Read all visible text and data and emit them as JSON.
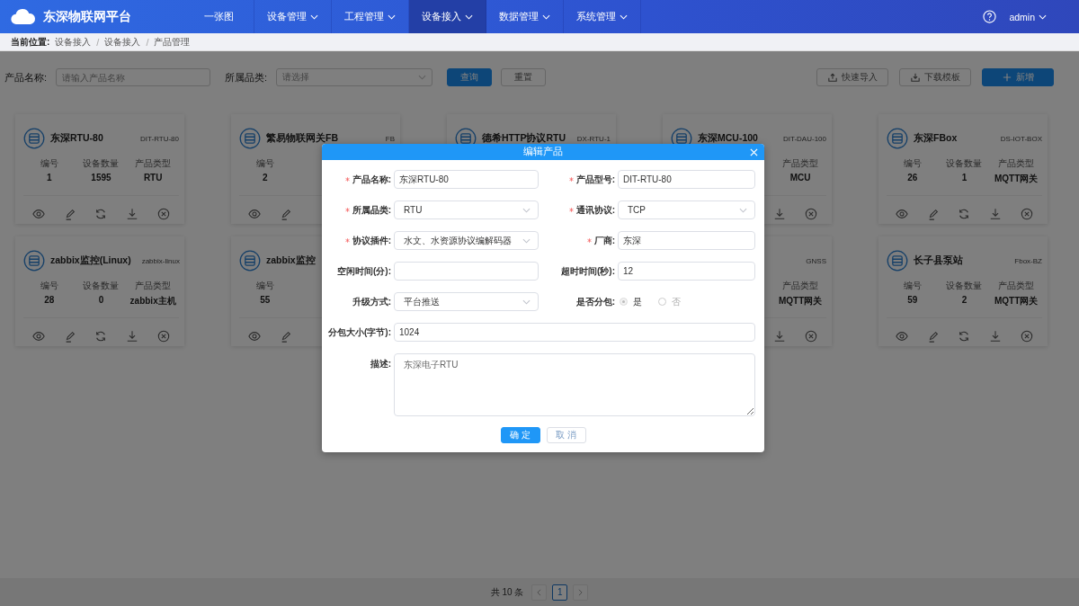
{
  "header": {
    "logo": "东深物联网平台",
    "nav": [
      {
        "label": "一张图",
        "dropdown": false,
        "selected": false
      },
      {
        "label": "设备管理",
        "dropdown": true,
        "selected": false
      },
      {
        "label": "工程管理",
        "dropdown": true,
        "selected": false
      },
      {
        "label": "设备接入",
        "dropdown": true,
        "selected": true
      },
      {
        "label": "数据管理",
        "dropdown": true,
        "selected": false
      },
      {
        "label": "系统管理",
        "dropdown": true,
        "selected": false
      }
    ],
    "user": "admin"
  },
  "breadcrumb": {
    "label": "当前位置:",
    "separator": "/",
    "items": [
      "设备接入",
      "设备接入",
      "产品管理"
    ]
  },
  "toolbar": {
    "filters": [
      {
        "label": "产品名称:",
        "kind": "text",
        "placeholder": "请输入产品名称"
      },
      {
        "label": "所属品类:",
        "kind": "select",
        "placeholder": "请选择"
      }
    ],
    "buttons": [
      {
        "label": "查询",
        "kind": "primary"
      },
      {
        "label": "重置",
        "kind": "default"
      }
    ],
    "actions": [
      {
        "label": "快速导入",
        "kind": "import"
      },
      {
        "label": "下载模板",
        "kind": "download"
      },
      {
        "label": "新增",
        "kind": "add"
      }
    ]
  },
  "card_rows": [
    [
      [
        {
          "title": "东深RTU-80",
          "code": "DIT-RTU-80",
          "stats": [
            {
              "kind": "id",
              "label": "编号",
              "value": "1"
            },
            {
              "kind": "count",
              "label": "设备数量",
              "value": "1595"
            },
            {
              "kind": "type",
              "label": "产品类型",
              "value": "RTU"
            }
          ],
          "actions": [
            {
              "kind": "view"
            },
            {
              "kind": "edit"
            },
            {
              "kind": "sync"
            },
            {
              "kind": "download"
            },
            {
              "kind": "delete"
            }
          ]
        },
        {
          "title": "繁易物联网关FB",
          "code": "FB",
          "stats": [
            {
              "kind": "id",
              "label": "编号",
              "value": "2"
            }
          ],
          "actions": [
            {
              "kind": "view"
            },
            {
              "kind": "edit"
            }
          ]
        },
        {
          "title": "德希HTTP协议RTU",
          "code": "DX-RTU-1"
        },
        {
          "title": "东深MCU-100",
          "code": "DIT-DAU-100",
          "stats": [
            {
              "kind": "type",
              "label": "产品类型",
              "value": "MCU"
            }
          ],
          "actions": [
            {
              "kind": "download"
            },
            {
              "kind": "delete"
            }
          ]
        },
        {
          "title": "东深FBox",
          "code": "DS-IOT-BOX",
          "stats": [
            {
              "kind": "id",
              "label": "编号",
              "value": "26"
            },
            {
              "kind": "count",
              "label": "设备数量",
              "value": "1"
            },
            {
              "kind": "type",
              "label": "产品类型",
              "value": "MQTT网关"
            }
          ],
          "actions": [
            {
              "kind": "view"
            },
            {
              "kind": "edit"
            },
            {
              "kind": "sync"
            },
            {
              "kind": "download"
            },
            {
              "kind": "delete"
            }
          ]
        }
      ]
    ],
    [
      [
        {
          "title": "zabbix监控(Linux)",
          "code": "zabbix-linux",
          "stats": [
            {
              "kind": "id",
              "label": "编号",
              "value": "28"
            },
            {
              "kind": "count",
              "label": "设备数量",
              "value": "0"
            },
            {
              "kind": "type",
              "label": "产品类型",
              "value": "zabbix主机"
            }
          ],
          "actions": [
            {
              "kind": "view"
            },
            {
              "kind": "edit"
            },
            {
              "kind": "sync"
            },
            {
              "kind": "download"
            },
            {
              "kind": "delete"
            }
          ]
        },
        {
          "title": "zabbix监控",
          "stats": [
            {
              "kind": "id",
              "label": "编号",
              "value": "55"
            }
          ],
          "actions": [
            {
              "kind": "view"
            },
            {
              "kind": "edit"
            }
          ]
        }
      ],
      [
        {
          "code": "GNSS",
          "stats": [
            {
              "kind": "type",
              "label": "产品类型",
              "value": "MQTT网关"
            }
          ],
          "actions": [
            {
              "kind": "download"
            },
            {
              "kind": "delete"
            }
          ]
        },
        {
          "title": "长子县泵站",
          "code": "Fbox-BZ",
          "stats": [
            {
              "kind": "id",
              "label": "编号",
              "value": "59"
            },
            {
              "kind": "count",
              "label": "设备数量",
              "value": "2"
            },
            {
              "kind": "type",
              "label": "产品类型",
              "value": "MQTT网关"
            }
          ],
          "actions": [
            {
              "kind": "view"
            },
            {
              "kind": "edit"
            },
            {
              "kind": "sync"
            },
            {
              "kind": "download"
            },
            {
              "kind": "delete"
            }
          ]
        }
      ]
    ]
  ],
  "pagination": {
    "total": "共 10 条",
    "pages": [
      {
        "label": "1",
        "selected": true
      }
    ]
  },
  "dialog": {
    "title": "编辑产品",
    "rows": [
      [
        {
          "label": "产品名称:",
          "required": true,
          "kind": "text",
          "value": "东深RTU-80"
        },
        {
          "label": "产品型号:",
          "required": true,
          "kind": "text",
          "value": "DIT-RTU-80"
        }
      ],
      [
        {
          "label": "所属品类:",
          "required": true,
          "kind": "select",
          "value": "RTU"
        },
        {
          "label": "通讯协议:",
          "required": true,
          "kind": "select",
          "value": "TCP"
        }
      ],
      [
        {
          "label": "协议插件:",
          "required": true,
          "kind": "select",
          "value": "水文、水资源协议编解码器"
        },
        {
          "label": "厂商:",
          "required": true,
          "kind": "text",
          "value": "东深"
        }
      ],
      [
        {
          "label": "空闲时间(分):",
          "required": false,
          "kind": "text"
        },
        {
          "label": "超时时间(秒):",
          "required": false,
          "kind": "text",
          "value": "12"
        }
      ],
      [
        {
          "label": "升级方式:",
          "required": false,
          "kind": "select",
          "value": "平台推送"
        },
        {
          "label": "是否分包:",
          "required": false,
          "kind": "radio",
          "disabled": true,
          "options": [
            {
              "label": "是",
              "selected": true
            },
            {
              "label": "否",
              "selected": false
            }
          ]
        }
      ],
      [
        {
          "label": "分包大小(字节):",
          "required": false,
          "kind": "text",
          "value": "1024"
        }
      ],
      [
        {
          "label": "描述:",
          "required": false,
          "kind": "textarea",
          "value": "东深电子RTU"
        }
      ]
    ],
    "buttons": [
      {
        "label": "确 定",
        "kind": "primary"
      },
      {
        "label": "取 消",
        "kind": "default"
      }
    ]
  }
}
